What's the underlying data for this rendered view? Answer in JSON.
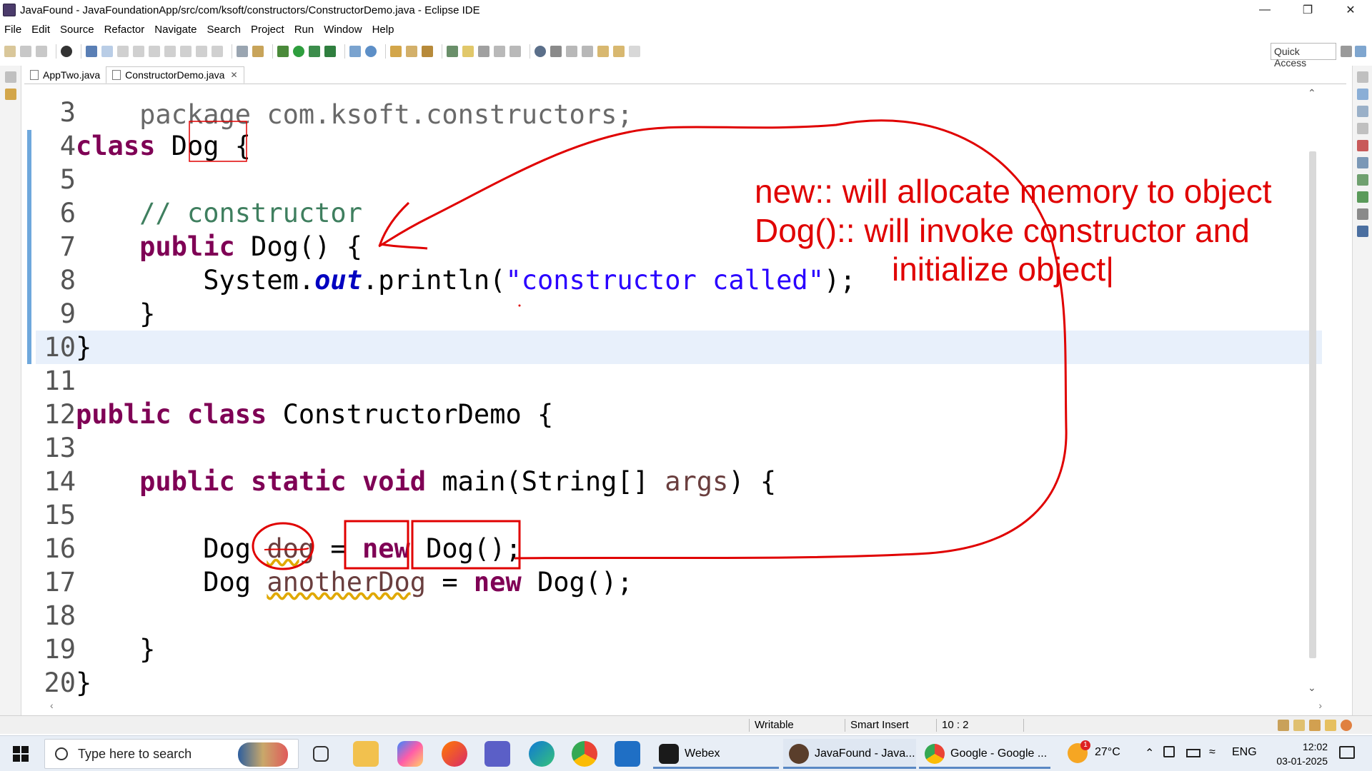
{
  "window": {
    "title": "JavaFound - JavaFoundationApp/src/com/ksoft/constructors/ConstructorDemo.java - Eclipse IDE",
    "minimize": "—",
    "restore": "❐",
    "close": "✕"
  },
  "menu": [
    "File",
    "Edit",
    "Source",
    "Refactor",
    "Navigate",
    "Search",
    "Project",
    "Run",
    "Window",
    "Help"
  ],
  "toolbar": {
    "quick_access": "Quick Access"
  },
  "tabs": [
    {
      "label": "AppTwo.java",
      "active": false
    },
    {
      "label": "ConstructorDemo.java",
      "active": true,
      "close": "✕"
    }
  ],
  "code": {
    "lines": [
      {
        "n": "3",
        "tokens": []
      },
      {
        "n": "4",
        "tokens": [
          [
            "kw",
            "class"
          ],
          [
            "tx",
            " Dog "
          ],
          [
            "tx",
            "{"
          ]
        ]
      },
      {
        "n": "5",
        "tokens": []
      },
      {
        "n": "6",
        "tokens": [
          [
            "tx",
            "    "
          ],
          [
            "cm",
            "// constructor"
          ]
        ]
      },
      {
        "n": "7",
        "tokens": [
          [
            "tx",
            "    "
          ],
          [
            "kw",
            "public"
          ],
          [
            "tx",
            " Dog() {"
          ]
        ]
      },
      {
        "n": "8",
        "tokens": [
          [
            "tx",
            "        System."
          ],
          [
            "fld",
            "out"
          ],
          [
            "tx",
            ".println("
          ],
          [
            "st",
            "\"constructor called\""
          ],
          [
            "tx",
            ");"
          ]
        ]
      },
      {
        "n": "9",
        "tokens": [
          [
            "tx",
            "    }"
          ]
        ]
      },
      {
        "n": "10",
        "tokens": [
          [
            "tx",
            "}"
          ]
        ]
      },
      {
        "n": "11",
        "tokens": []
      },
      {
        "n": "12",
        "tokens": [
          [
            "kw",
            "public"
          ],
          [
            "tx",
            " "
          ],
          [
            "kw",
            "class"
          ],
          [
            "tx",
            " ConstructorDemo {"
          ]
        ]
      },
      {
        "n": "13",
        "tokens": []
      },
      {
        "n": "14",
        "tokens": [
          [
            "tx",
            "    "
          ],
          [
            "kw",
            "public"
          ],
          [
            "tx",
            " "
          ],
          [
            "kw",
            "static"
          ],
          [
            "tx",
            " "
          ],
          [
            "kw",
            "void"
          ],
          [
            "tx",
            " main(String[] "
          ],
          [
            "var",
            "args"
          ],
          [
            "tx",
            ") {"
          ]
        ]
      },
      {
        "n": "15",
        "tokens": []
      },
      {
        "n": "16",
        "tokens": [
          [
            "tx",
            "        Dog "
          ],
          [
            "varw",
            "dog"
          ],
          [
            "tx",
            " = "
          ],
          [
            "kw",
            "new"
          ],
          [
            "tx",
            " Dog();"
          ]
        ]
      },
      {
        "n": "17",
        "tokens": [
          [
            "tx",
            "        Dog "
          ],
          [
            "varw",
            "anotherDog"
          ],
          [
            "tx",
            " = "
          ],
          [
            "kw",
            "new"
          ],
          [
            "tx",
            " Dog();"
          ]
        ]
      },
      {
        "n": "18",
        "tokens": []
      },
      {
        "n": "19",
        "tokens": [
          [
            "tx",
            "    }"
          ]
        ]
      },
      {
        "n": "20",
        "tokens": [
          [
            "tx",
            "}"
          ]
        ]
      }
    ],
    "partial_top_line": "package com.ksoft.constructors;"
  },
  "annotation": {
    "line1": "new:: will allocate memory to object",
    "line2": "Dog():: will invoke constructor and",
    "line3": "initialize object|",
    "color": "#e00000"
  },
  "status": {
    "writable": "Writable",
    "insert_mode": "Smart Insert",
    "position": "10 : 2"
  },
  "taskbar": {
    "search_placeholder": "Type here to search",
    "tasks": [
      {
        "label": "Webex"
      },
      {
        "label": "JavaFound - Java..."
      },
      {
        "label": "Google - Google ..."
      }
    ],
    "weather": "27°C",
    "weather_badge": "1",
    "language": "ENG",
    "time": "12:02",
    "date": "03-01-2025"
  },
  "colors": {
    "keyword": "#7f0055",
    "comment": "#3f7f5f",
    "string": "#2a00ff",
    "field": "#0000c0",
    "annotation": "#e00000"
  }
}
